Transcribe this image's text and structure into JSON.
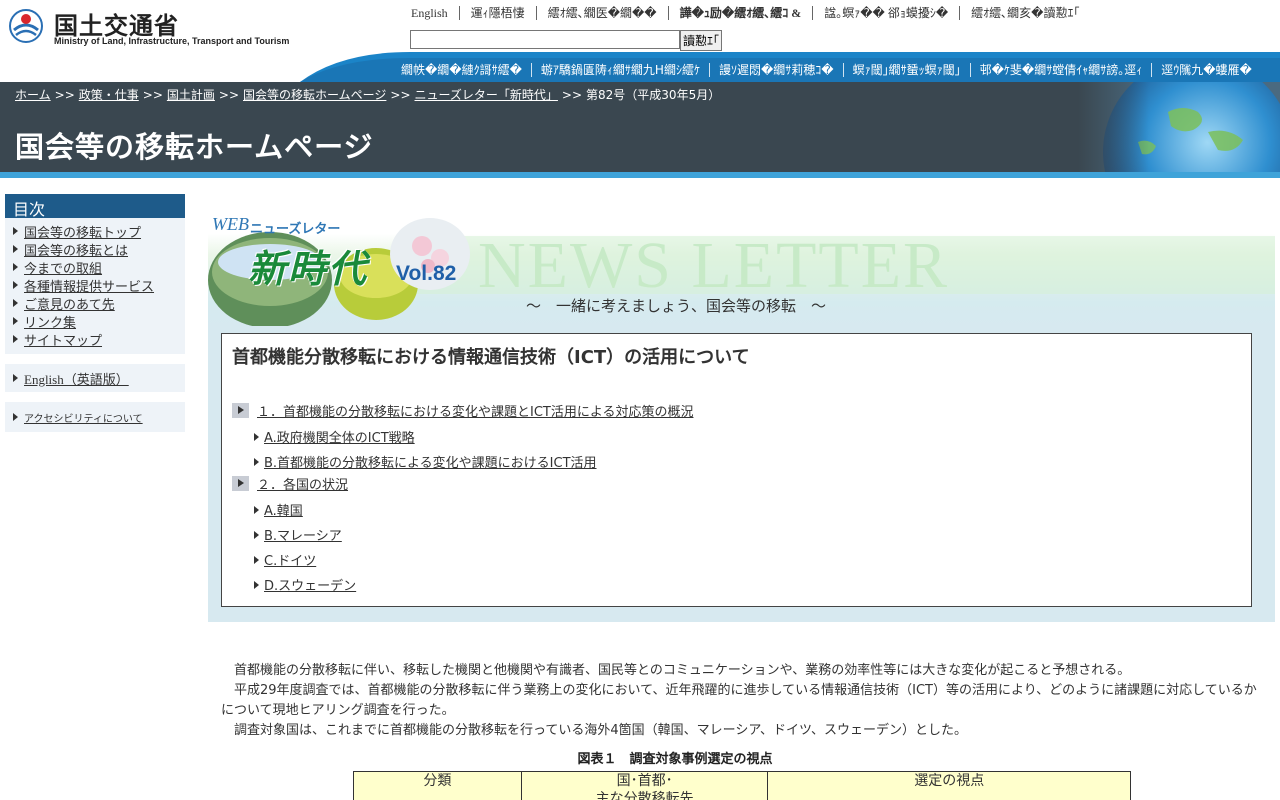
{
  "header": {
    "logo_jp": "国土交通省",
    "logo_en": "Ministry of Land, Infrastructure, Transport and Tourism",
    "util_links": [
      {
        "label": "English",
        "bold": false
      },
      {
        "label": "運ｨ隱梧悽",
        "bold": false
      },
      {
        "label": "繧ｵ繧､繝医�繝��",
        "bold": false
      },
      {
        "label": "譁�ｭ励�繧ｵ繧､繧ｺ &",
        "bold": true
      },
      {
        "label": "諡｡螟ｧ�� 郤ｮ蟆擾ｼ�",
        "bold": false
      },
      {
        "label": "繧ｵ繧､繝亥�讀懃ｴ｢",
        "bold": false
      }
    ],
    "search": {
      "value": "",
      "button": "讀懃ｴ｢"
    },
    "main_nav": [
      "繝帙�繝�縺ｸ謌ｻ繧�",
      "蝣ｱ驕鍋匱陦ｨ繝ｻ繝九Η繝ｼ繧ｹ",
      "謾ｿ遲悶�繝ｻ莉穂ｺ�",
      "螟ｧ閾｣繝ｻ蜑ｯ螟ｧ閾｣",
      "邨�ｹ斐�繝ｻ螳倩ｲｬ繝ｻ謗｡逕ｨ",
      "逕ｳ隲九�螻雁�"
    ]
  },
  "breadcrumb": [
    {
      "label": "ホーム",
      "link": true
    },
    {
      "label": "政策・仕事",
      "link": true
    },
    {
      "label": "国土計画",
      "link": true
    },
    {
      "label": "国会等の移転ホームページ",
      "link": true
    },
    {
      "label": "ニューズレター「新時代」",
      "link": true
    },
    {
      "label": "第82号（平成30年5月）",
      "link": false
    }
  ],
  "breadcrumb_sep": ">>",
  "site_title": "国会等の移転ホームページ",
  "sidebar": {
    "toc_title": "目次",
    "items": [
      "国会等の移転トップ",
      "国会等の移転とは",
      "今までの取組",
      "各種情報提供サービス",
      "ご意見のあて先",
      "リンク集",
      "サイトマップ"
    ],
    "english": "English（英語版）",
    "accessibility": "アクセシビリティについて"
  },
  "newsletter": {
    "web": "WEB",
    "label": "ニューズレター",
    "name": "新時代",
    "vol": "Vol.82",
    "bg_text": "NEWS LETTER",
    "subtitle": "～　一緒に考えましょう、国会等の移転　～"
  },
  "contents": {
    "title": "首都機能分散移転における情報通信技術（ICT）の活用について",
    "sections": [
      {
        "label": "１．首都機能の分散移転における変化や課題とICT活用による対応策の概況",
        "subs": [
          "A.政府機関全体のICT戦略",
          "B.首都機能の分散移転による変化や課題におけるICT活用"
        ]
      },
      {
        "label": "２．各国の状況",
        "subs": [
          "A.韓国",
          "B.マレーシア",
          "C.ドイツ",
          "D.スウェーデン"
        ]
      }
    ]
  },
  "body": {
    "p1": "首都機能の分散移転に伴い、移転した機関と他機関や有識者、国民等とのコミュニケーションや、業務の効率性等には大きな変化が起こると予想される。",
    "p2": "平成29年度調査では、首都機能の分散移転に伴う業務上の変化において、近年飛躍的に進歩している情報通信技術（ICT）等の活用により、どのように諸課題に対応しているかについて現地ヒアリング調査を行った。",
    "p3": "調査対象国は、これまでに首都機能の分散移転を行っている海外4箇国（韓国、マレーシア、ドイツ、スウェーデン）とした。",
    "figure_caption": "図表１　調査対象事例選定の視点",
    "table_headers": [
      "分類",
      "国･首都･\n主な分散移転先",
      "選定の視点"
    ]
  },
  "colors": {
    "title_band": "#3a4750",
    "accent_blue": "#3fa3d9",
    "toc_head": "#1e5b8a",
    "table_header_bg": "#ffffcc"
  }
}
